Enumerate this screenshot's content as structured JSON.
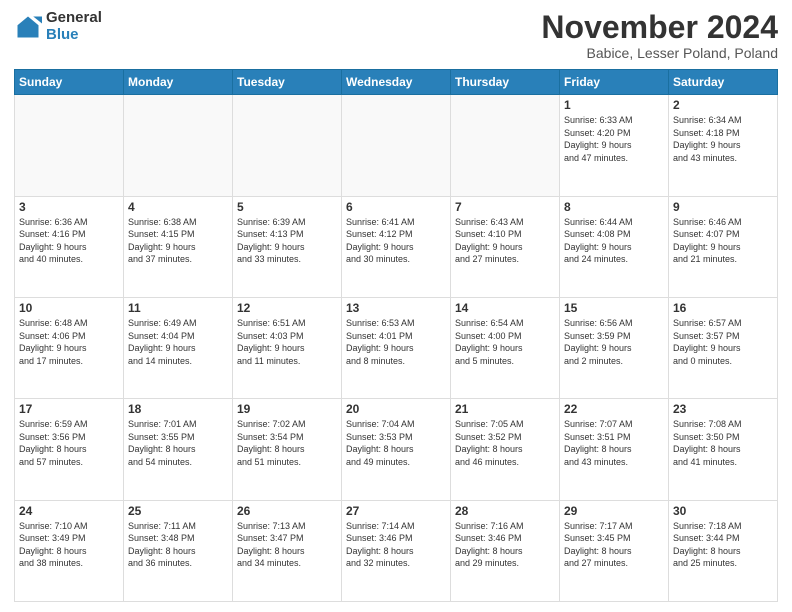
{
  "logo": {
    "general": "General",
    "blue": "Blue"
  },
  "header": {
    "month": "November 2024",
    "location": "Babice, Lesser Poland, Poland"
  },
  "weekdays": [
    "Sunday",
    "Monday",
    "Tuesday",
    "Wednesday",
    "Thursday",
    "Friday",
    "Saturday"
  ],
  "weeks": [
    [
      {
        "day": "",
        "info": ""
      },
      {
        "day": "",
        "info": ""
      },
      {
        "day": "",
        "info": ""
      },
      {
        "day": "",
        "info": ""
      },
      {
        "day": "",
        "info": ""
      },
      {
        "day": "1",
        "info": "Sunrise: 6:33 AM\nSunset: 4:20 PM\nDaylight: 9 hours\nand 47 minutes."
      },
      {
        "day": "2",
        "info": "Sunrise: 6:34 AM\nSunset: 4:18 PM\nDaylight: 9 hours\nand 43 minutes."
      }
    ],
    [
      {
        "day": "3",
        "info": "Sunrise: 6:36 AM\nSunset: 4:16 PM\nDaylight: 9 hours\nand 40 minutes."
      },
      {
        "day": "4",
        "info": "Sunrise: 6:38 AM\nSunset: 4:15 PM\nDaylight: 9 hours\nand 37 minutes."
      },
      {
        "day": "5",
        "info": "Sunrise: 6:39 AM\nSunset: 4:13 PM\nDaylight: 9 hours\nand 33 minutes."
      },
      {
        "day": "6",
        "info": "Sunrise: 6:41 AM\nSunset: 4:12 PM\nDaylight: 9 hours\nand 30 minutes."
      },
      {
        "day": "7",
        "info": "Sunrise: 6:43 AM\nSunset: 4:10 PM\nDaylight: 9 hours\nand 27 minutes."
      },
      {
        "day": "8",
        "info": "Sunrise: 6:44 AM\nSunset: 4:08 PM\nDaylight: 9 hours\nand 24 minutes."
      },
      {
        "day": "9",
        "info": "Sunrise: 6:46 AM\nSunset: 4:07 PM\nDaylight: 9 hours\nand 21 minutes."
      }
    ],
    [
      {
        "day": "10",
        "info": "Sunrise: 6:48 AM\nSunset: 4:06 PM\nDaylight: 9 hours\nand 17 minutes."
      },
      {
        "day": "11",
        "info": "Sunrise: 6:49 AM\nSunset: 4:04 PM\nDaylight: 9 hours\nand 14 minutes."
      },
      {
        "day": "12",
        "info": "Sunrise: 6:51 AM\nSunset: 4:03 PM\nDaylight: 9 hours\nand 11 minutes."
      },
      {
        "day": "13",
        "info": "Sunrise: 6:53 AM\nSunset: 4:01 PM\nDaylight: 9 hours\nand 8 minutes."
      },
      {
        "day": "14",
        "info": "Sunrise: 6:54 AM\nSunset: 4:00 PM\nDaylight: 9 hours\nand 5 minutes."
      },
      {
        "day": "15",
        "info": "Sunrise: 6:56 AM\nSunset: 3:59 PM\nDaylight: 9 hours\nand 2 minutes."
      },
      {
        "day": "16",
        "info": "Sunrise: 6:57 AM\nSunset: 3:57 PM\nDaylight: 9 hours\nand 0 minutes."
      }
    ],
    [
      {
        "day": "17",
        "info": "Sunrise: 6:59 AM\nSunset: 3:56 PM\nDaylight: 8 hours\nand 57 minutes."
      },
      {
        "day": "18",
        "info": "Sunrise: 7:01 AM\nSunset: 3:55 PM\nDaylight: 8 hours\nand 54 minutes."
      },
      {
        "day": "19",
        "info": "Sunrise: 7:02 AM\nSunset: 3:54 PM\nDaylight: 8 hours\nand 51 minutes."
      },
      {
        "day": "20",
        "info": "Sunrise: 7:04 AM\nSunset: 3:53 PM\nDaylight: 8 hours\nand 49 minutes."
      },
      {
        "day": "21",
        "info": "Sunrise: 7:05 AM\nSunset: 3:52 PM\nDaylight: 8 hours\nand 46 minutes."
      },
      {
        "day": "22",
        "info": "Sunrise: 7:07 AM\nSunset: 3:51 PM\nDaylight: 8 hours\nand 43 minutes."
      },
      {
        "day": "23",
        "info": "Sunrise: 7:08 AM\nSunset: 3:50 PM\nDaylight: 8 hours\nand 41 minutes."
      }
    ],
    [
      {
        "day": "24",
        "info": "Sunrise: 7:10 AM\nSunset: 3:49 PM\nDaylight: 8 hours\nand 38 minutes."
      },
      {
        "day": "25",
        "info": "Sunrise: 7:11 AM\nSunset: 3:48 PM\nDaylight: 8 hours\nand 36 minutes."
      },
      {
        "day": "26",
        "info": "Sunrise: 7:13 AM\nSunset: 3:47 PM\nDaylight: 8 hours\nand 34 minutes."
      },
      {
        "day": "27",
        "info": "Sunrise: 7:14 AM\nSunset: 3:46 PM\nDaylight: 8 hours\nand 32 minutes."
      },
      {
        "day": "28",
        "info": "Sunrise: 7:16 AM\nSunset: 3:46 PM\nDaylight: 8 hours\nand 29 minutes."
      },
      {
        "day": "29",
        "info": "Sunrise: 7:17 AM\nSunset: 3:45 PM\nDaylight: 8 hours\nand 27 minutes."
      },
      {
        "day": "30",
        "info": "Sunrise: 7:18 AM\nSunset: 3:44 PM\nDaylight: 8 hours\nand 25 minutes."
      }
    ]
  ]
}
